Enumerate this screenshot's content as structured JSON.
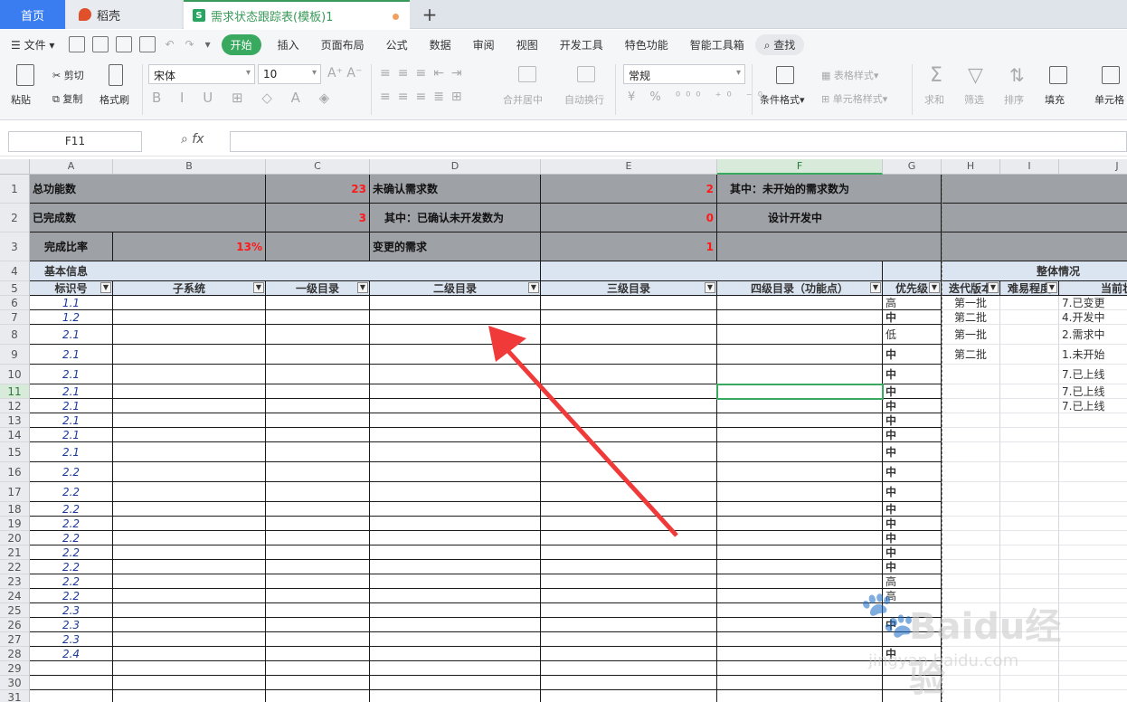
{
  "tabs": {
    "home": "首页",
    "daoke": "稻壳",
    "doc": "需求状态跟踪表(模板)1",
    "new": "+"
  },
  "menu": {
    "file": "文件",
    "items": [
      "开始",
      "插入",
      "页面布局",
      "公式",
      "数据",
      "审阅",
      "视图",
      "开发工具",
      "特色功能",
      "智能工具箱"
    ],
    "search": "查找"
  },
  "ribbon": {
    "paste": "粘贴",
    "cut": "剪切",
    "copy": "复制",
    "format_painter": "格式刷",
    "font_name": "宋体",
    "font_size": "10",
    "merge": "合并居中",
    "wrap": "自动换行",
    "number_format": "常规",
    "cond_format": "条件格式",
    "table_style": "表格样式",
    "cell_style": "单元格样式",
    "sum": "求和",
    "filter": "筛选",
    "sort": "排序",
    "fill": "填充",
    "cell": "单元格"
  },
  "formula": {
    "namebox": "F11",
    "fx": "fx",
    "value": ""
  },
  "columns": [
    "A",
    "B",
    "C",
    "D",
    "E",
    "F",
    "G",
    "H",
    "I",
    "J"
  ],
  "rows": [
    "1",
    "2",
    "3",
    "4",
    "5",
    "6",
    "7",
    "8",
    "9",
    "10",
    "11",
    "12",
    "13",
    "14",
    "15",
    "16",
    "17",
    "18",
    "19",
    "20",
    "21",
    "22",
    "23",
    "24",
    "25",
    "26",
    "27",
    "28",
    "29",
    "30",
    "31"
  ],
  "summary": {
    "r1": {
      "a": "总功能数",
      "c": "23",
      "d": "未确认需求数",
      "e": "2",
      "f": "其中：未开始的需求数为"
    },
    "r2": {
      "a": "已完成数",
      "c": "3",
      "d": "其中：已确认未开发数为",
      "e": "0",
      "f": "设计开发中"
    },
    "r3": {
      "a": "完成比率",
      "b": "13%",
      "d": "变更的需求",
      "e": "1"
    }
  },
  "section": {
    "basic": "基本信息",
    "overall": "整体情况"
  },
  "headers": [
    "标识号",
    "子系统",
    "一级目录",
    "二级目录",
    "三级目录",
    "四级目录（功能点）",
    "优先级",
    "迭代版本",
    "难易程度",
    "当前状"
  ],
  "ids": [
    "1.1",
    "1.2",
    "2.1",
    "2.1",
    "2.1",
    "2.1",
    "2.1",
    "2.1",
    "2.1",
    "2.1",
    "2.2",
    "2.2",
    "2.2",
    "2.2",
    "2.2",
    "2.2",
    "2.2",
    "2.2",
    "2.2",
    "2.3",
    "2.3",
    "2.3",
    "2.4"
  ],
  "priority": [
    "高",
    "中",
    "低",
    "中",
    "中",
    "中",
    "中",
    "中",
    "中",
    "中",
    "中",
    "中",
    "中",
    "中",
    "中",
    "中",
    "中",
    "高",
    "高",
    "",
    "中",
    "",
    "中"
  ],
  "iteration": [
    "第一批",
    "第二批",
    "第一批",
    "第二批"
  ],
  "status": [
    "7.已变更",
    "4.开发中",
    "2.需求中",
    "1.未开始",
    "7.已上线",
    "7.已上线",
    "7.已上线"
  ],
  "watermark": {
    "text": "Baidu经验",
    "url": "jingyan.baidu.com"
  }
}
